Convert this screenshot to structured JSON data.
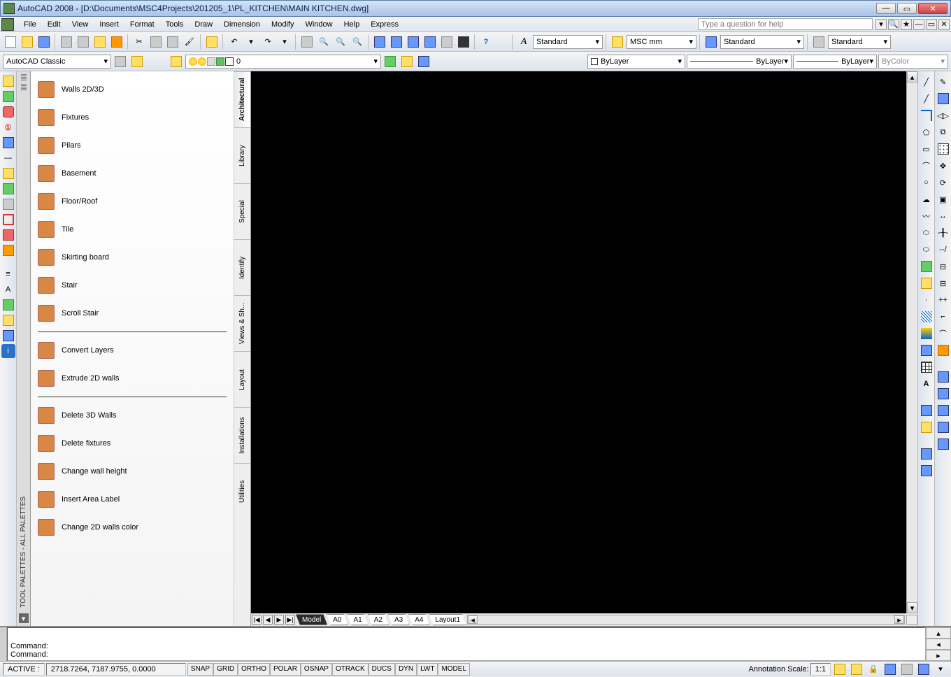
{
  "titlebar": {
    "title": "AutoCAD 2008 - [D:\\Documents\\MSC4Projects\\201205_1\\PL_KITCHEN\\MAIN KITCHEN.dwg]"
  },
  "menubar": {
    "items": [
      "File",
      "Edit",
      "View",
      "Insert",
      "Format",
      "Tools",
      "Draw",
      "Dimension",
      "Modify",
      "Window",
      "Help",
      "Express"
    ],
    "help_placeholder": "Type a question for help"
  },
  "toolbar1": {
    "style_text": "Standard",
    "dim_text": "MSC mm",
    "table_text": "Standard",
    "ml_text": "Standard"
  },
  "toolbar2": {
    "workspace": "AutoCAD Classic",
    "layer_value": "0",
    "color_value": "ByLayer",
    "linetype_value": "ByLayer",
    "lineweight_value": "ByLayer",
    "plotstyle_value": "ByColor"
  },
  "palettes": {
    "bar_title": "TOOL PALETTES - ALL PALETTES",
    "tabs": [
      "Architectural",
      "Library",
      "Special",
      "Identify",
      "Views & Sh...",
      "Layout",
      "Installations",
      "Utilities"
    ],
    "groups": [
      [
        {
          "label": "Walls 2D/3D",
          "icon": "i-orange"
        },
        {
          "label": "Fixtures",
          "icon": "i-orange"
        },
        {
          "label": "Pilars",
          "icon": "i-yellow"
        },
        {
          "label": "Basement",
          "icon": "i-red"
        },
        {
          "label": "Floor/Roof",
          "icon": "i-gray"
        },
        {
          "label": "Tile",
          "icon": "i-gray"
        },
        {
          "label": "Skirting board",
          "icon": "i-orange"
        },
        {
          "label": "Stair",
          "icon": "i-gray"
        },
        {
          "label": "Scroll Stair",
          "icon": "i-gray"
        }
      ],
      [
        {
          "label": "Convert Layers",
          "icon": "i-yellow"
        },
        {
          "label": "Extrude 2D walls",
          "icon": "i-orange"
        }
      ],
      [
        {
          "label": "Delete 3D Walls",
          "icon": "i-orange"
        },
        {
          "label": "Delete fixtures",
          "icon": "i-orange"
        },
        {
          "label": "Change wall height",
          "icon": "i-green"
        },
        {
          "label": "Insert Area Label",
          "icon": "i-blue"
        },
        {
          "label": "Change 2D walls color",
          "icon": "i-orange"
        }
      ]
    ]
  },
  "layout_tabs": {
    "navs": [
      "|◀",
      "◀",
      "▶",
      "▶|"
    ],
    "tabs": [
      "Model",
      "A0",
      "A1",
      "A2",
      "A3",
      "A4",
      "Layout1"
    ],
    "active": "Model"
  },
  "cmdline": {
    "line1": "Command:",
    "line2": "Command:"
  },
  "statusbar": {
    "active_label": "ACTIVE :",
    "coords": "2718.7264,  7187.9755, 0.0000",
    "toggles": [
      "SNAP",
      "GRID",
      "ORTHO",
      "POLAR",
      "OSNAP",
      "OTRACK",
      "DUCS",
      "DYN",
      "LWT",
      "MODEL"
    ],
    "anno_label": "Annotation Scale:",
    "anno_value": "1:1"
  }
}
